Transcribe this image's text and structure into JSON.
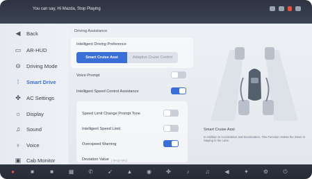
{
  "topbar": {
    "voice_hint": "You can say, Hi Mazda, Stop Playing",
    "icons": [
      "wifi-icon",
      "signal-icon",
      "record-icon",
      "battery-icon"
    ],
    "accent": "#e6503c"
  },
  "sidebar": {
    "items": [
      {
        "label": "Back",
        "icon": "back-icon",
        "glyph": "◀"
      },
      {
        "label": "AR-HUD",
        "icon": "hud-icon",
        "glyph": "▭"
      },
      {
        "label": "Driving Mode",
        "icon": "steering-wheel-icon",
        "glyph": "⊖"
      },
      {
        "label": "Smart Drive",
        "icon": "lane-icon",
        "glyph": "⁞"
      },
      {
        "label": "AC Settings",
        "icon": "fan-icon",
        "glyph": "✤"
      },
      {
        "label": "Display",
        "icon": "brightness-icon",
        "glyph": "☼"
      },
      {
        "label": "Sound",
        "icon": "speaker-icon",
        "glyph": "♫"
      },
      {
        "label": "Voice",
        "icon": "microphone-icon",
        "glyph": "♁"
      },
      {
        "label": "Cab Monitor",
        "icon": "monitor-icon",
        "glyph": "▣"
      }
    ],
    "active_index": 3,
    "active_color": "#3a6fd8"
  },
  "content": {
    "section_title": "Driving Assistance",
    "preference_label": "Intelligent Driving Preference",
    "segments": [
      "Smart Cruise Asst",
      "Adaptive Cruise Control"
    ],
    "selected_segment": 0,
    "voice_prompt": {
      "label": "Voice Prompt",
      "on": false
    },
    "speed_control": {
      "label": "Intelligent Speed Control Assistance",
      "on": true
    },
    "speed_limit_tone": {
      "label": "Speed Limit Change Prompt Tone",
      "on": false
    },
    "intelligent_speed_limit": {
      "label": "Intelligent Speed Limit",
      "on": false
    },
    "overspeed_warning": {
      "label": "Overspeed Warning",
      "on": true
    },
    "deviation": {
      "label": "Deviation Value",
      "range": "(-9%)(+9%)"
    }
  },
  "right_panel": {
    "info_title": "Smart Cruise Asst",
    "info_desc": "In Addition to Acceleration and Deceleration, This Function Assists the Driver in Staying in the Lane."
  },
  "dock": {
    "icons": [
      "home-icon",
      "radio-icon",
      "media-icon",
      "grid-icon",
      "phone-icon",
      "navigation-icon",
      "car-icon",
      "camera-icon",
      "fan-icon",
      "seat-icon",
      "music-icon",
      "volume-icon",
      "climate-icon",
      "settings-icon"
    ]
  }
}
